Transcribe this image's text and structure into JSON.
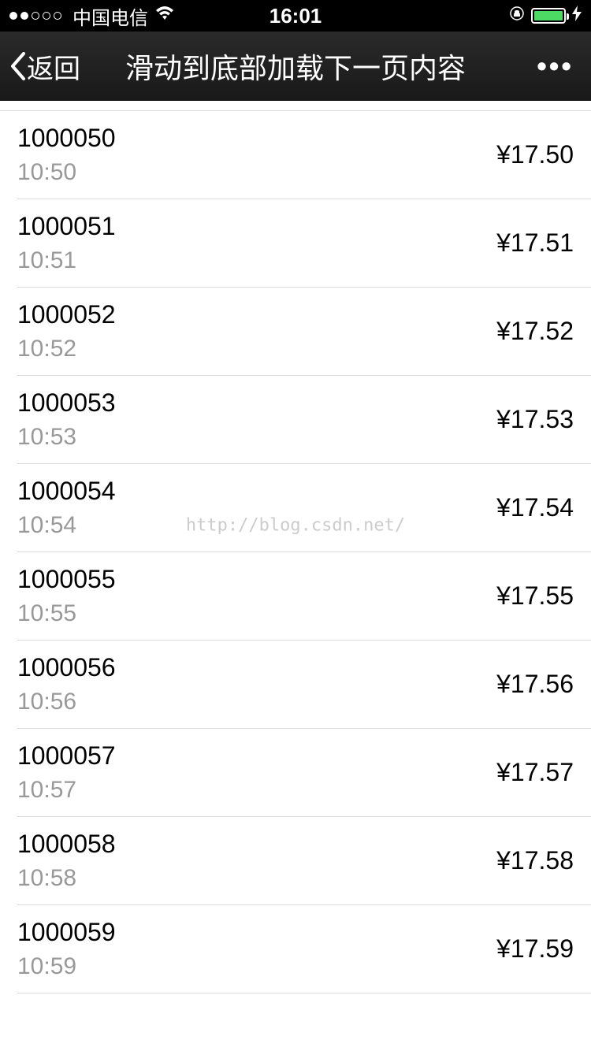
{
  "status": {
    "carrier": "中国电信",
    "time": "16:01"
  },
  "nav": {
    "back": "返回",
    "title": "滑动到底部加载下一页内容"
  },
  "watermark": "http://blog.csdn.net/",
  "list": [
    {
      "id": "1000050",
      "time": "10:50",
      "price": "¥17.50"
    },
    {
      "id": "1000051",
      "time": "10:51",
      "price": "¥17.51"
    },
    {
      "id": "1000052",
      "time": "10:52",
      "price": "¥17.52"
    },
    {
      "id": "1000053",
      "time": "10:53",
      "price": "¥17.53"
    },
    {
      "id": "1000054",
      "time": "10:54",
      "price": "¥17.54"
    },
    {
      "id": "1000055",
      "time": "10:55",
      "price": "¥17.55"
    },
    {
      "id": "1000056",
      "time": "10:56",
      "price": "¥17.56"
    },
    {
      "id": "1000057",
      "time": "10:57",
      "price": "¥17.57"
    },
    {
      "id": "1000058",
      "time": "10:58",
      "price": "¥17.58"
    },
    {
      "id": "1000059",
      "time": "10:59",
      "price": "¥17.59"
    }
  ]
}
